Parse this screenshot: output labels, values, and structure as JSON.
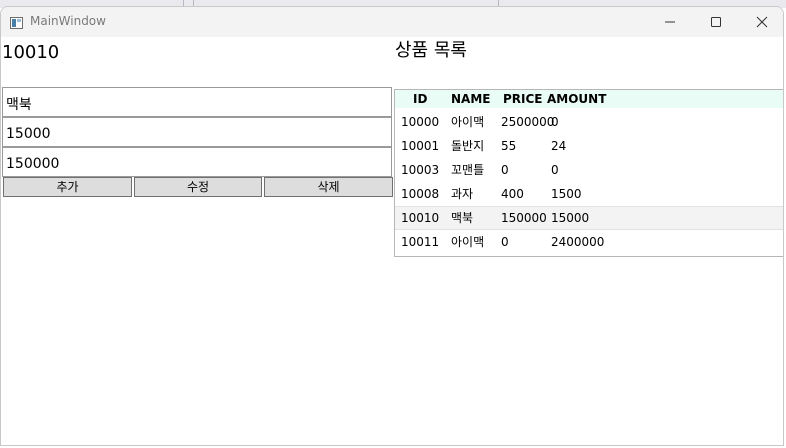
{
  "window": {
    "title": "MainWindow"
  },
  "selected_id": "10010",
  "list_title": "상품 목록",
  "form": {
    "name_value": "맥북",
    "price_value": "15000",
    "amount_value": "150000"
  },
  "buttons": {
    "add": "추가",
    "edit": "수정",
    "delete": "삭제"
  },
  "table": {
    "headers": {
      "id": "ID",
      "name": "NAME",
      "price": "PRICE",
      "amount": "AMOUNT"
    },
    "rows": [
      {
        "id": "10000",
        "name": "아이맥",
        "price": "2500000",
        "amount": "0"
      },
      {
        "id": "10001",
        "name": "돌반지",
        "price": "55",
        "amount": "24"
      },
      {
        "id": "10003",
        "name": "꼬맨틀",
        "price": "0",
        "amount": "0"
      },
      {
        "id": "10008",
        "name": "과자",
        "price": "400",
        "amount": "1500"
      },
      {
        "id": "10010",
        "name": "맥북",
        "price": "150000",
        "amount": "15000"
      },
      {
        "id": "10011",
        "name": "아이맥",
        "price": "0",
        "amount": "2400000"
      }
    ],
    "selected_row": 4
  }
}
